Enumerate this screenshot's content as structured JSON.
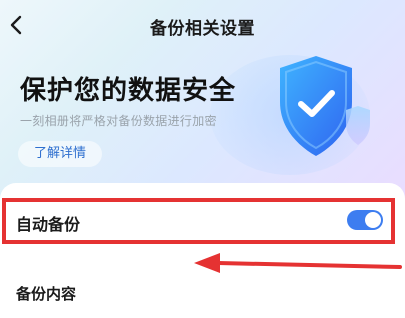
{
  "header": {
    "title": "备份相关设置",
    "back_icon": "chevron-left-icon"
  },
  "hero": {
    "title": "保护您的数据安全",
    "subtitle": "一刻相册将严格对备份数据进行加密",
    "learn_more": "了解详情",
    "illustration": "shield-check-icon"
  },
  "settings": {
    "auto_backup": {
      "label": "自动备份",
      "enabled": true
    },
    "backup_content": {
      "label": "备份内容"
    }
  },
  "annotation": {
    "highlight_color": "#e53232",
    "arrow_direction": "left"
  },
  "colors": {
    "accent": "#3d7df0",
    "link": "#2e6fcf"
  }
}
